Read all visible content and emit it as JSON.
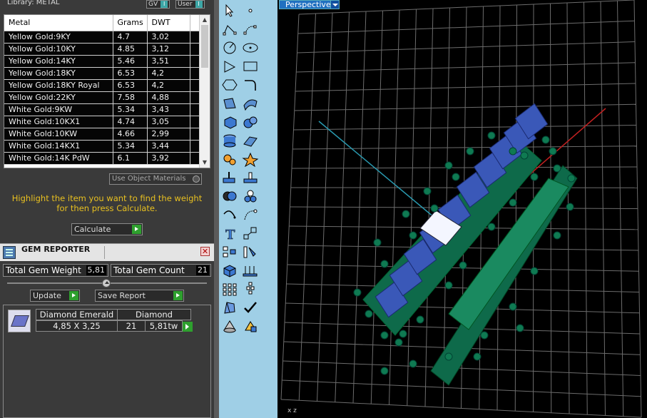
{
  "library": {
    "title": "Library: METAL",
    "gv_label": "GV",
    "user_label": "User"
  },
  "metal_table": {
    "columns": [
      "Metal",
      "Grams",
      "DWT"
    ],
    "rows": [
      {
        "metal": "Yellow Gold:9KY",
        "grams": "4.7",
        "dwt": "3,02"
      },
      {
        "metal": "Yellow Gold:10KY",
        "grams": "4.85",
        "dwt": "3,12"
      },
      {
        "metal": "Yellow Gold:14KY",
        "grams": "5.46",
        "dwt": "3,51"
      },
      {
        "metal": "Yellow Gold:18KY",
        "grams": "6.53",
        "dwt": "4,2"
      },
      {
        "metal": "Yellow Gold:18KY Royal",
        "grams": "6.53",
        "dwt": "4,2"
      },
      {
        "metal": "Yellow Gold:22KY",
        "grams": "7.58",
        "dwt": "4,88"
      },
      {
        "metal": "White Gold:9KW",
        "grams": "5.34",
        "dwt": "3,43"
      },
      {
        "metal": "White Gold:10KX1",
        "grams": "4.74",
        "dwt": "3,05"
      },
      {
        "metal": "White Gold:10KW",
        "grams": "4.66",
        "dwt": "2,99"
      },
      {
        "metal": "White Gold:14KX1",
        "grams": "5.34",
        "dwt": "3,44"
      },
      {
        "metal": "White Gold:14K PdW",
        "grams": "6.1",
        "dwt": "3,92"
      }
    ]
  },
  "use_object_materials_label": "Use Object Materials",
  "hint_text": "Highlight the item you want to find the weight for then press Calculate.",
  "calculate_label": "Calculate",
  "gem_reporter": {
    "title": "GEM REPORTER",
    "total_weight_label": "Total Gem Weight",
    "total_weight_value": "5,81",
    "total_count_label": "Total Gem Count",
    "total_count_value": "21",
    "update_label": "Update",
    "save_report_label": "Save Report",
    "gems": [
      {
        "cut": "Diamond Emerald",
        "size": "4,85 X 3,25",
        "material": "Diamond",
        "count": "21",
        "weight": "5,81tw"
      }
    ]
  },
  "viewport": {
    "view_label": "Perspective",
    "axis_label": "x  z"
  },
  "toolbar_icons": [
    "select-arrow-icon",
    "point-icon",
    "polyline-icon",
    "control-points-icon",
    "circle-icon",
    "ellipse-icon",
    "polygon-icon",
    "rectangle-icon",
    "hexagon-icon",
    "fillet-curve-icon",
    "transform-icon",
    "surface-icon",
    "box-icon",
    "spheres-icon",
    "cylinder-icon",
    "flat-surface-icon",
    "gear-settings-icon",
    "explode-icon",
    "split-icon",
    "join-icon",
    "boolean-icon",
    "group-icon",
    "arc-icon",
    "rebuild-curve-icon",
    "text-icon",
    "scale-icon",
    "align-icon",
    "measure-icon",
    "solid-box-icon",
    "array-arrows-icon",
    "grid-array-icon",
    "vertical-array-icon",
    "gem-cutter-icon",
    "checkmark-icon",
    "cone-icon",
    "render-icon"
  ],
  "colors": {
    "panel_bg": "#3a3a3a",
    "toolbar_bg": "#9fcfe6",
    "hint_yellow": "#e8c020",
    "go_green": "#2ea02e",
    "viewport_tab": "#2070c0",
    "gem_blue": "#3a58b8",
    "metal_green": "#0e6a4a"
  }
}
